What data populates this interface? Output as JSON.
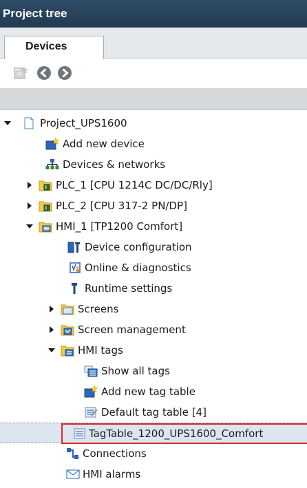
{
  "panel": {
    "title": "Project tree"
  },
  "tabs": [
    {
      "label": "Devices"
    }
  ],
  "toolbar": {
    "buttons": [
      {
        "icon": "add-device-icon"
      },
      {
        "icon": "back-arrow-icon"
      },
      {
        "icon": "forward-arrow-icon"
      }
    ]
  },
  "tree": {
    "items": [
      {
        "label": "Project_UPS1600",
        "icon": "project-page-icon",
        "expanded": true
      },
      {
        "label": "Add new device",
        "icon": "add-new-device-icon"
      },
      {
        "label": "Devices & networks",
        "icon": "network-icon"
      },
      {
        "label": "PLC_1 [CPU 1214C DC/DC/Rly]",
        "icon": "plc-folder-icon",
        "expanded": false
      },
      {
        "label": "PLC_2 [CPU 317-2 PN/DP]",
        "icon": "plc-folder-icon",
        "expanded": false
      },
      {
        "label": "HMI_1 [TP1200 Comfort]",
        "icon": "hmi-folder-icon",
        "expanded": true
      },
      {
        "label": "Device configuration",
        "icon": "device-configuration-icon"
      },
      {
        "label": "Online & diagnostics",
        "icon": "online-diagnostics-icon"
      },
      {
        "label": "Runtime settings",
        "icon": "runtime-settings-icon"
      },
      {
        "label": "Screens",
        "icon": "screens-folder-icon",
        "expanded": false
      },
      {
        "label": "Screen management",
        "icon": "screen-management-folder-icon",
        "expanded": false
      },
      {
        "label": "HMI tags",
        "icon": "hmi-tags-folder-icon",
        "expanded": true
      },
      {
        "label": "Show all tags",
        "icon": "show-all-tags-icon"
      },
      {
        "label": "Add new tag table",
        "icon": "add-tag-table-icon"
      },
      {
        "label": "Default tag table [4]",
        "icon": "tag-table-icon"
      },
      {
        "label": "TagTable_1200_UPS1600_Comfort",
        "icon": "tag-table-icon",
        "selected": true
      },
      {
        "label": "Connections",
        "icon": "connections-icon"
      },
      {
        "label": "HMI alarms",
        "icon": "hmi-alarms-icon"
      }
    ]
  },
  "colors": {
    "title_bg": "#2b4560",
    "selection_bg": "#dde6f0",
    "highlight_border": "#d42b2b",
    "folder_yellow": "#f2c94c"
  }
}
